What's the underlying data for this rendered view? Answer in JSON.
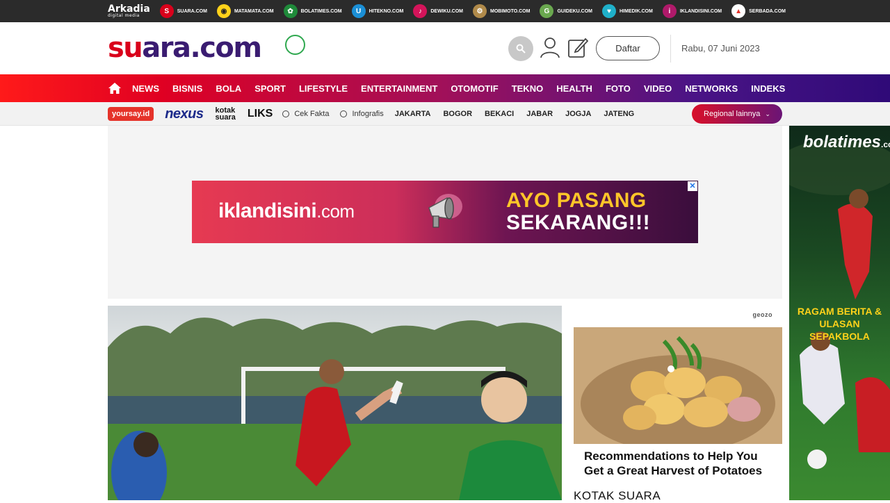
{
  "topbar": {
    "brand": "Arkadia",
    "brand_sub": "digital media",
    "networks": [
      {
        "name": "SUARA.COM",
        "icon": "suara-icon",
        "color": "#d9001b",
        "glyph": "S"
      },
      {
        "name": "MATAMATA.COM",
        "icon": "matamata-icon",
        "color": "#ffd21a",
        "glyph": "◉"
      },
      {
        "name": "BOLATIMES.COM",
        "icon": "bolatimes-icon",
        "color": "#1f8a3a",
        "glyph": "✿"
      },
      {
        "name": "HITEKNO.COM",
        "icon": "hitekno-icon",
        "color": "#1b8fd6",
        "glyph": "U"
      },
      {
        "name": "DEWIKU.COM",
        "icon": "dewiku-icon",
        "color": "#d4145a",
        "glyph": "♪"
      },
      {
        "name": "MOBIMOTO.COM",
        "icon": "mobimoto-icon",
        "color": "#b08a4a",
        "glyph": "⚙"
      },
      {
        "name": "GUIDEKU.COM",
        "icon": "guideku-icon",
        "color": "#6aa84f",
        "glyph": "G"
      },
      {
        "name": "HIMEDIK.COM",
        "icon": "himedik-icon",
        "color": "#1fb0c9",
        "glyph": "♥"
      },
      {
        "name": "IKLANDISINI.COM",
        "icon": "iklandisini-icon",
        "color": "#b01a6a",
        "glyph": "i"
      },
      {
        "name": "SERBADA.COM",
        "icon": "serbada-icon",
        "color": "#ffffff",
        "glyph": "▲"
      }
    ]
  },
  "header": {
    "logo_red": "su",
    "logo_purple": "ara.com",
    "register_label": "Daftar",
    "date": "Rabu, 07 Juni 2023"
  },
  "main_nav": [
    "NEWS",
    "BISNIS",
    "BOLA",
    "SPORT",
    "LIFESTYLE",
    "ENTERTAINMENT",
    "OTOMOTIF",
    "TEKNO",
    "HEALTH",
    "FOTO",
    "VIDEO",
    "NETWORKS",
    "INDEKS"
  ],
  "sub_nav": {
    "yoursay": "yoursay.id",
    "nexus": "nexus",
    "kotak_1": "kotak",
    "kotak_2": "suara",
    "liks": "LIKS",
    "links": [
      "Cek Fakta",
      "Infografis"
    ],
    "regions": [
      "JAKARTA",
      "BOGOR",
      "BEKACI",
      "JABAR",
      "JOGJA",
      "JATENG"
    ],
    "regional_button": "Regional lainnya"
  },
  "ad_banner": {
    "brand_main": "iklandisini",
    "brand_domain": ".com",
    "cta_line1": "AYO PASANG",
    "cta_line2": "SEKARANG!!!",
    "close": "✕"
  },
  "sidebar": {
    "provider": "geozo",
    "recommendation_title": "Recommendations to Help You Get a Great Harvest of Potatoes",
    "section_title": "KOTAK SUARA"
  },
  "skyscraper": {
    "brand": "bolatimes",
    "brand_domain": ".com",
    "tagline_1": "RAGAM BERITA &",
    "tagline_2": "ULASAN SEPAKBOLA"
  }
}
